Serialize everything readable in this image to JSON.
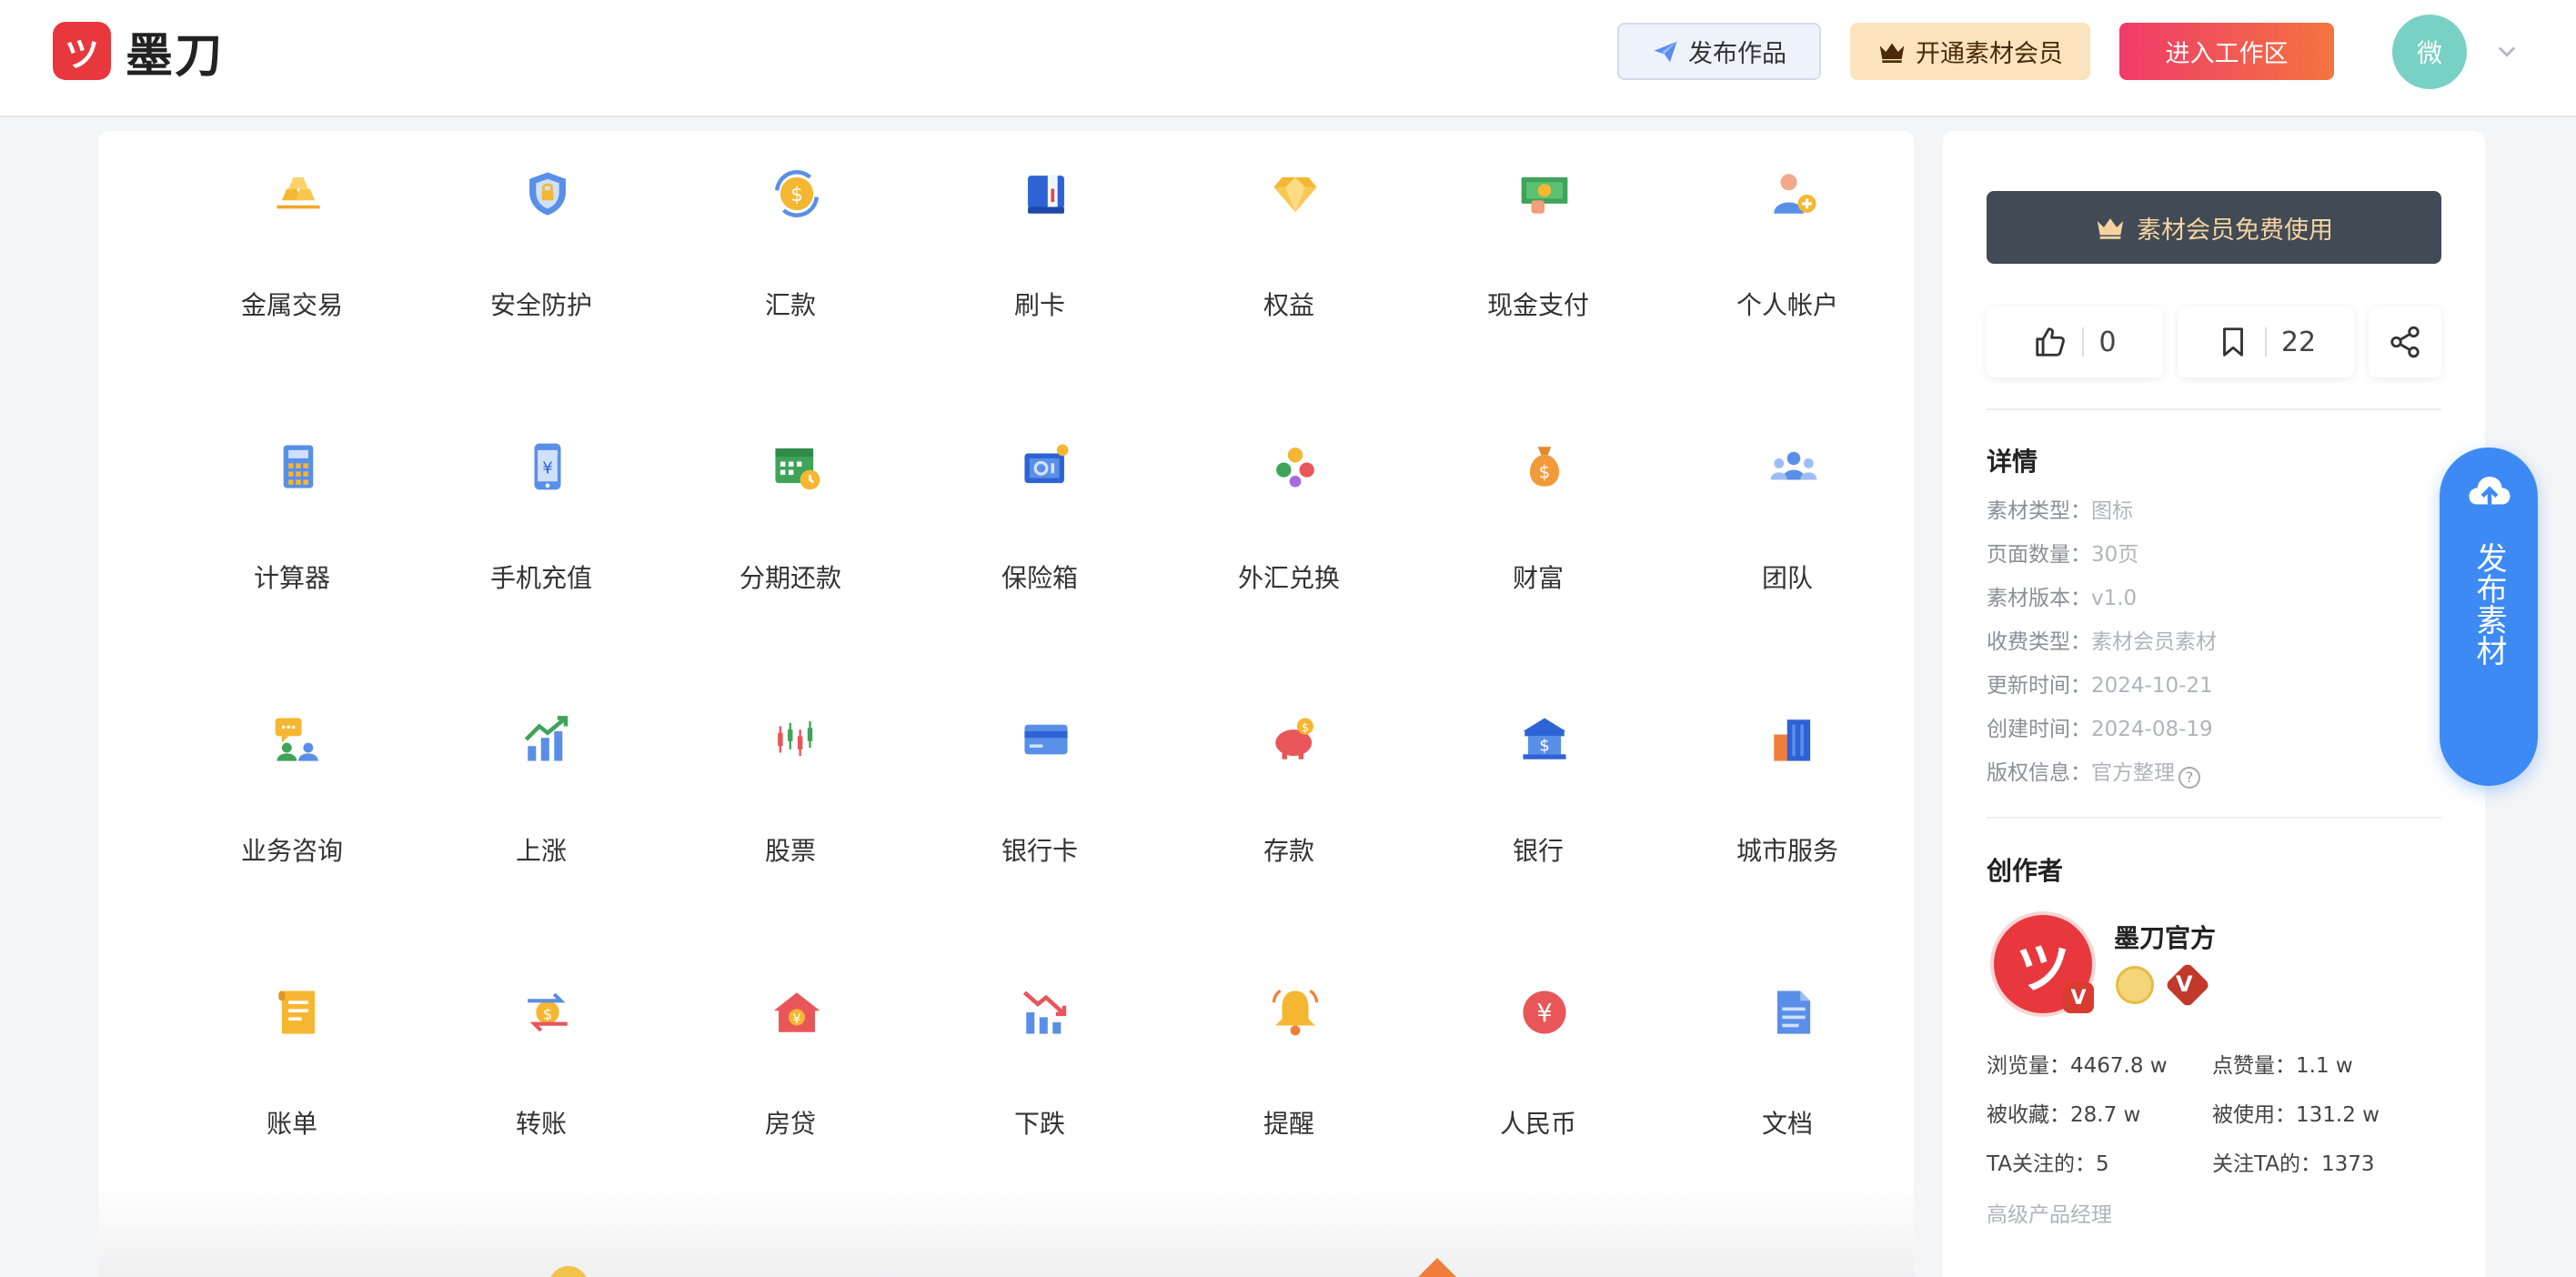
{
  "header": {
    "logo_mark": "ツ",
    "logo_text": "墨刀",
    "publish_label": "发布作品",
    "vip_label": "开通素材会员",
    "workspace_label": "进入工作区",
    "avatar_text": "微"
  },
  "icons": [
    {
      "label": "金属交易",
      "icon": "gold-bars-icon"
    },
    {
      "label": "安全防护",
      "icon": "shield-icon"
    },
    {
      "label": "汇款",
      "icon": "coin-exchange-icon"
    },
    {
      "label": "刷卡",
      "icon": "card-swipe-icon"
    },
    {
      "label": "权益",
      "icon": "diamond-icon"
    },
    {
      "label": "现金支付",
      "icon": "cash-icon"
    },
    {
      "label": "个人帐户",
      "icon": "user-account-icon"
    },
    {
      "label": "计算器",
      "icon": "calculator-icon"
    },
    {
      "label": "手机充值",
      "icon": "phone-topup-icon"
    },
    {
      "label": "分期还款",
      "icon": "calendar-payment-icon"
    },
    {
      "label": "保险箱",
      "icon": "safe-icon"
    },
    {
      "label": "外汇兑换",
      "icon": "currency-exchange-icon"
    },
    {
      "label": "财富",
      "icon": "money-bag-icon"
    },
    {
      "label": "团队",
      "icon": "team-icon"
    },
    {
      "label": "业务咨询",
      "icon": "consultation-icon"
    },
    {
      "label": "上涨",
      "icon": "rising-chart-icon"
    },
    {
      "label": "股票",
      "icon": "candlestick-icon"
    },
    {
      "label": "银行卡",
      "icon": "bank-card-icon"
    },
    {
      "label": "存款",
      "icon": "piggy-bank-icon"
    },
    {
      "label": "银行",
      "icon": "bank-icon"
    },
    {
      "label": "城市服务",
      "icon": "city-buildings-icon"
    },
    {
      "label": "账单",
      "icon": "bill-icon"
    },
    {
      "label": "转账",
      "icon": "transfer-icon"
    },
    {
      "label": "房贷",
      "icon": "house-loan-icon"
    },
    {
      "label": "下跌",
      "icon": "falling-chart-icon"
    },
    {
      "label": "提醒",
      "icon": "bell-icon"
    },
    {
      "label": "人民币",
      "icon": "rmb-coin-icon"
    },
    {
      "label": "文档",
      "icon": "document-icon"
    }
  ],
  "sidebar": {
    "vip_free_label": "素材会员免费使用",
    "likes": "0",
    "favorites": "22",
    "details_title": "详情",
    "details": [
      {
        "key": "素材类型：",
        "value": "图标"
      },
      {
        "key": "页面数量：",
        "value": "30页"
      },
      {
        "key": "素材版本：",
        "value": "v1.0"
      },
      {
        "key": "收费类型：",
        "value": "素材会员素材"
      },
      {
        "key": "更新时间：",
        "value": "2024-10-21"
      },
      {
        "key": "创建时间：",
        "value": "2024-08-19"
      },
      {
        "key": "版权信息：",
        "value": "官方整理"
      }
    ],
    "help_mark": "?",
    "creator_title": "创作者",
    "creator_name": "墨刀官方",
    "creator_avatar_mark": "ツ",
    "verified_mark": "V",
    "stats": {
      "views": "浏览量：4467.8 w",
      "likes": "点赞量：1.1 w",
      "collected": "被收藏：28.7 w",
      "used": "被使用：131.2 w",
      "following": "TA关注的：5",
      "followers": "关注TA的：1373"
    },
    "creator_role": "高级产品经理"
  },
  "float_publish": {
    "label": "发布素材"
  },
  "colors": {
    "brand_red": "#e8383d",
    "accent_blue": "#3d8af4",
    "vip_gold": "#fbe3bd",
    "dark_button": "#414a55"
  }
}
